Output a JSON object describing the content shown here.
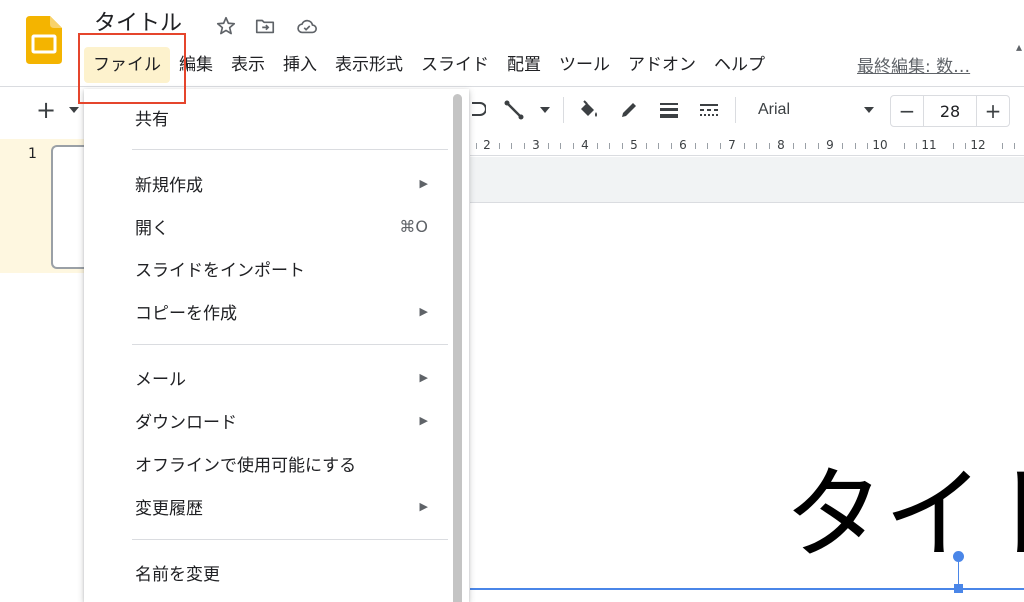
{
  "header": {
    "title": "タイトル",
    "menu": [
      {
        "name": "menu-file",
        "label": "ファイル",
        "active": true
      },
      {
        "name": "menu-edit",
        "label": "編集"
      },
      {
        "name": "menu-view",
        "label": "表示"
      },
      {
        "name": "menu-insert",
        "label": "挿入"
      },
      {
        "name": "menu-format",
        "label": "表示形式"
      },
      {
        "name": "menu-slide",
        "label": "スライド"
      },
      {
        "name": "menu-arrange",
        "label": "配置"
      },
      {
        "name": "menu-tools",
        "label": "ツール"
      },
      {
        "name": "menu-addons",
        "label": "アドオン"
      },
      {
        "name": "menu-help",
        "label": "ヘルプ"
      }
    ],
    "last_edit": "最終編集: 数…",
    "icons": [
      "star-icon",
      "move-to-folder-icon",
      "cloud-status-icon"
    ]
  },
  "toolbar": {
    "add_label": "+",
    "font_name": "Arial",
    "font_size": "28",
    "minus_label": "−",
    "plus_label": "+",
    "icons": [
      "add-icon",
      "dropdown-arrow-icon",
      "shape-icon",
      "line-icon",
      "line-dropdown-icon",
      "fill-color-icon",
      "border-color-icon",
      "border-weight-icon",
      "border-dash-icon"
    ]
  },
  "ruler": {
    "labels": [
      "2",
      "3",
      "4",
      "5",
      "6",
      "7",
      "8",
      "9",
      "10",
      "11",
      "12"
    ]
  },
  "filmstrip": {
    "slide_number": "1"
  },
  "slide": {
    "title_text": "タイト"
  },
  "file_menu": {
    "items": [
      {
        "name": "share",
        "label": "共有"
      },
      {
        "name": "new",
        "label": "新規作成",
        "submenu": true
      },
      {
        "name": "open",
        "label": "開く",
        "shortcut": "⌘O"
      },
      {
        "name": "import-slides",
        "label": "スライドをインポート"
      },
      {
        "name": "make-copy",
        "label": "コピーを作成",
        "submenu": true
      },
      {
        "name": "email",
        "label": "メール",
        "submenu": true
      },
      {
        "name": "download",
        "label": "ダウンロード",
        "submenu": true
      },
      {
        "name": "make-offline",
        "label": "オフラインで使用可能にする"
      },
      {
        "name": "version-history",
        "label": "変更履歴",
        "submenu": true
      },
      {
        "name": "rename",
        "label": "名前を変更"
      }
    ],
    "submenu_arrow": "▶"
  },
  "colors": {
    "accent": "#4a86e8",
    "active_menu_bg": "#fdf2cd",
    "highlight_box": "#e5452c",
    "logo": "#f4b400"
  }
}
